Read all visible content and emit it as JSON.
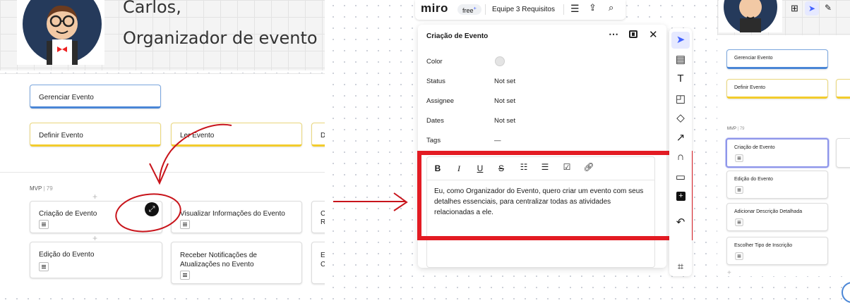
{
  "left_board": {
    "persona_name_partial": "Carlos,",
    "persona_role": "Organizador de evento",
    "cards_top": [
      "Gerenciar Evento",
      "Definir Evento",
      "Ler Evento",
      "D"
    ],
    "mvp_label": "MVP",
    "mvp_count": "79",
    "cards": [
      "Criação de Evento",
      "Visualizar Informações  do Evento",
      "C",
      "R",
      "Edição do Evento",
      "Receber Notificações de Atualizações no Evento",
      "E",
      "C"
    ]
  },
  "miro": {
    "logo": "miro",
    "plan_badge": "free",
    "board_name": "Equipe 3 Requisitos"
  },
  "panel": {
    "title": "Criação de Evento",
    "props": [
      {
        "label": "Color",
        "value": ""
      },
      {
        "label": "Status",
        "value": "Not set"
      },
      {
        "label": "Assignee",
        "value": "Not set"
      },
      {
        "label": "Dates",
        "value": "Not set"
      },
      {
        "label": "Tags",
        "value": "—"
      }
    ],
    "toolbar": [
      "B",
      "I",
      "U",
      "S",
      "list-numbered",
      "list-bullet",
      "checklist",
      "link"
    ],
    "description": "Eu, como Organizador do Evento, quero criar um evento com seus detalhes essenciais, para centralizar todas as atividades relacionadas a ele."
  },
  "right_board": {
    "cards_top": [
      "Gerenciar Evento",
      "Definir Evento"
    ],
    "mvp_label": "MVP",
    "mvp_count": "79",
    "cards": [
      "Criação de Evento",
      "Edição do Evento",
      "Adicionar Descrição Detalhada",
      "Escolher Tipo de Inscrição"
    ]
  },
  "colors": {
    "highlight_red": "#e31b23",
    "accent_blue": "#4262ff",
    "yellow": "#f2cc2c"
  }
}
